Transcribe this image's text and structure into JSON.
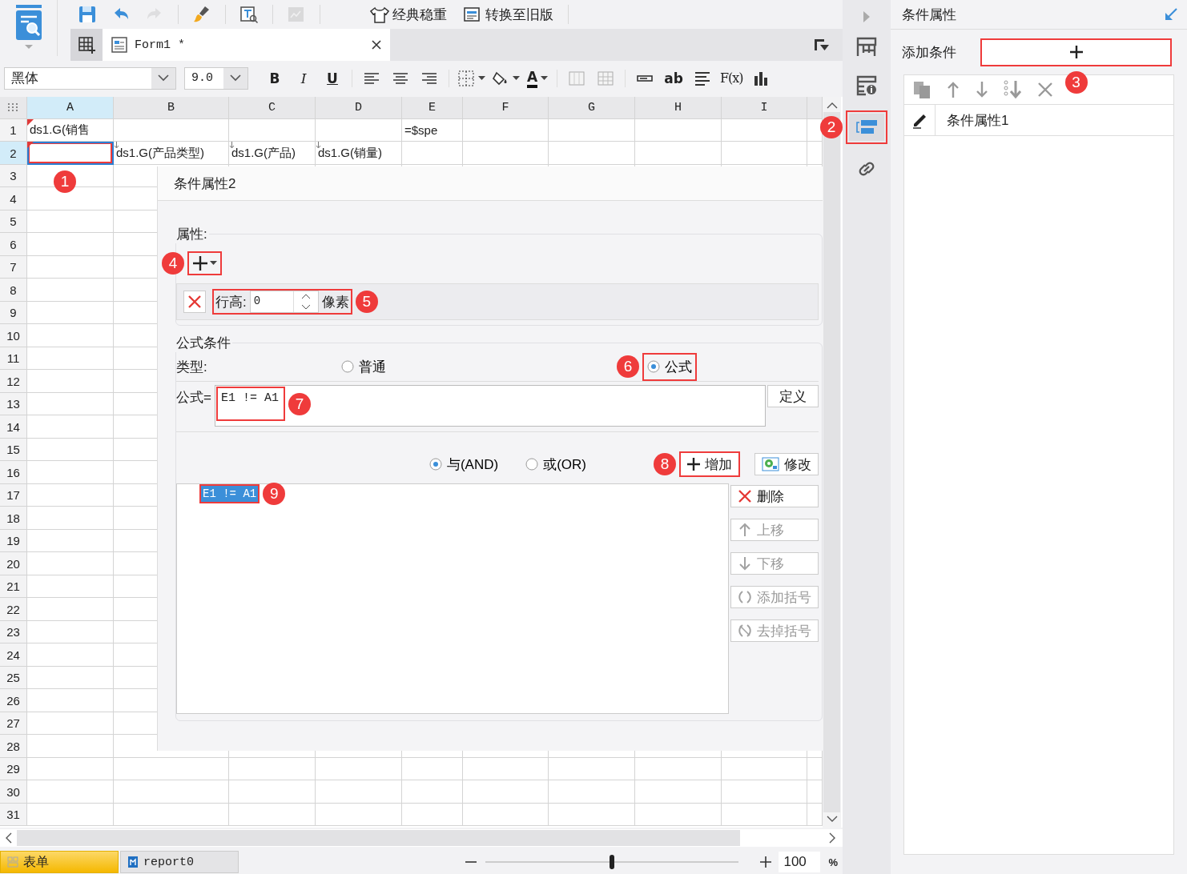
{
  "quick_tools": [
    {
      "kind": "save",
      "disabled": false
    },
    {
      "kind": "undo",
      "disabled": false
    },
    {
      "kind": "redo",
      "disabled": true
    },
    {
      "kind": "brush",
      "disabled": false
    },
    {
      "kind": "preview",
      "disabled": false
    },
    {
      "kind": "chart-preview",
      "disabled": true
    }
  ],
  "theme_buttons": [
    {
      "kind": "theme",
      "label": "经典稳重"
    },
    {
      "kind": "legacy",
      "label": "转换至旧版"
    }
  ],
  "tabs": [
    {
      "label": "Form1 *",
      "selected": true
    }
  ],
  "format_bar": {
    "font": "黑体",
    "size": "9.0"
  },
  "format_tools": [
    {
      "kind": "bold",
      "label": "B"
    },
    {
      "kind": "italic",
      "label": "I"
    },
    {
      "kind": "underline",
      "label": "U"
    },
    {
      "kind": "align-left"
    },
    {
      "kind": "align-center"
    },
    {
      "kind": "align-right"
    },
    {
      "kind": "border"
    },
    {
      "kind": "fill"
    },
    {
      "kind": "font-color",
      "label": "A"
    },
    {
      "kind": "merge"
    },
    {
      "kind": "unmerge"
    },
    {
      "kind": "widget"
    },
    {
      "kind": "text-widget",
      "label": "ab"
    },
    {
      "kind": "paragraph"
    },
    {
      "kind": "formula",
      "label": "F(x)"
    },
    {
      "kind": "chart"
    }
  ],
  "sheet": {
    "columns": [
      {
        "label": "A",
        "selected": true
      },
      {
        "label": "B",
        "selected": false
      },
      {
        "label": "C",
        "selected": false
      },
      {
        "label": "D",
        "selected": false
      },
      {
        "label": "E",
        "selected": false
      },
      {
        "label": "F",
        "selected": false
      },
      {
        "label": "G",
        "selected": false
      },
      {
        "label": "H",
        "selected": false
      },
      {
        "label": "I",
        "selected": false
      }
    ],
    "rows": [
      {
        "label": "1",
        "selected": false,
        "cells": [
          {
            "text": "ds1.G(销售",
            "selected": false,
            "corner_mark": true,
            "expand_down": false
          },
          {
            "selected": false,
            "corner_mark": false,
            "expand_down": false
          },
          {
            "selected": false,
            "corner_mark": false,
            "expand_down": false
          },
          {
            "selected": false,
            "corner_mark": false,
            "expand_down": false
          },
          {
            "text": "=$spe",
            "selected": false,
            "corner_mark": false,
            "expand_down": false
          }
        ]
      },
      {
        "label": "2",
        "selected": true,
        "cells": [
          {
            "selected": true,
            "corner_mark": true,
            "expand_down": false
          },
          {
            "text": "ds1.G(产品类型)",
            "selected": false,
            "corner_mark": false,
            "expand_down": true
          },
          {
            "text": "ds1.G(产品)",
            "selected": false,
            "corner_mark": false,
            "expand_down": true
          },
          {
            "text": "ds1.G(销量)",
            "selected": false,
            "corner_mark": false,
            "expand_down": true
          }
        ]
      },
      {
        "label": "3",
        "selected": false
      },
      {
        "label": "4",
        "selected": false
      },
      {
        "label": "5",
        "selected": false
      },
      {
        "label": "6",
        "selected": false
      },
      {
        "label": "7",
        "selected": false
      },
      {
        "label": "8",
        "selected": false
      },
      {
        "label": "9",
        "selected": false
      },
      {
        "label": "10",
        "selected": false
      },
      {
        "label": "11",
        "selected": false
      },
      {
        "label": "12",
        "selected": false
      },
      {
        "label": "13",
        "selected": false
      },
      {
        "label": "14",
        "selected": false
      },
      {
        "label": "15",
        "selected": false
      },
      {
        "label": "16",
        "selected": false
      },
      {
        "label": "17",
        "selected": false
      },
      {
        "label": "18",
        "selected": false
      },
      {
        "label": "19",
        "selected": false
      },
      {
        "label": "20",
        "selected": false
      },
      {
        "label": "21",
        "selected": false
      },
      {
        "label": "22",
        "selected": false
      },
      {
        "label": "23",
        "selected": false
      },
      {
        "label": "24",
        "selected": false
      },
      {
        "label": "25",
        "selected": false
      },
      {
        "label": "26",
        "selected": false
      },
      {
        "label": "27",
        "selected": false
      },
      {
        "label": "28",
        "selected": false
      },
      {
        "label": "29",
        "selected": false
      },
      {
        "label": "30",
        "selected": false
      },
      {
        "label": "31",
        "selected": false
      }
    ]
  },
  "dialog": {
    "title": "条件属性2",
    "properties": {
      "label": "属性:",
      "rows": [
        {
          "label": "行高:",
          "value": "0",
          "unit": "像素"
        }
      ]
    },
    "formula_condition": {
      "label": "公式条件",
      "type_label": "类型:",
      "types": [
        {
          "label": "普通",
          "selected": false
        },
        {
          "label": "公式",
          "selected": true
        }
      ],
      "formula_label": "公式=",
      "formula": "E1 != A1",
      "define_button": "定义",
      "logic": [
        {
          "label": "与(AND)",
          "selected": true
        },
        {
          "label": "或(OR)",
          "selected": false
        }
      ],
      "add_button": "增加",
      "modify_button": "修改",
      "conditions": [
        {
          "text": "E1 != A1",
          "selected": true
        }
      ],
      "side_buttons": [
        {
          "kind": "delete",
          "label": "删除",
          "disabled": false
        },
        {
          "kind": "up",
          "label": "上移",
          "disabled": true
        },
        {
          "kind": "down",
          "label": "下移",
          "disabled": true
        },
        {
          "kind": "add-brackets",
          "label": "添加括号",
          "disabled": true
        },
        {
          "kind": "remove-brackets",
          "label": "去掉括号",
          "disabled": true
        }
      ]
    }
  },
  "side_strip": [
    {
      "kind": "layout",
      "selected": false
    },
    {
      "kind": "info",
      "selected": false
    },
    {
      "kind": "condition",
      "selected": true
    },
    {
      "kind": "link",
      "selected": false
    }
  ],
  "panel": {
    "title": "条件属性",
    "add_label": "添加条件",
    "conditions": [
      {
        "label": "条件属性1",
        "selected": false
      }
    ]
  },
  "sheet_tabs": [
    {
      "label": "表单",
      "selected": true
    },
    {
      "label": "report0",
      "selected": false
    }
  ],
  "zoom": {
    "level": 0.5,
    "value": "100",
    "unit": "%"
  },
  "callouts": [
    "1",
    "2",
    "3",
    "4",
    "5",
    "6",
    "7",
    "8",
    "9"
  ]
}
